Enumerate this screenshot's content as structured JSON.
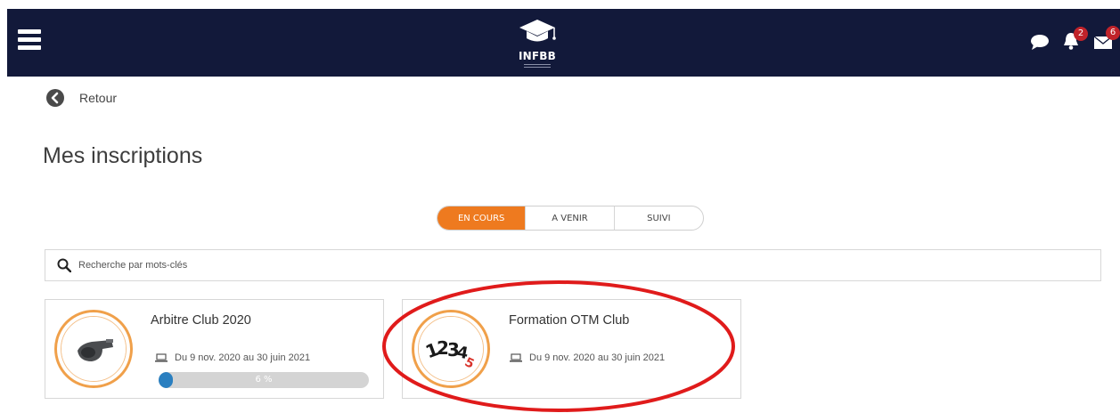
{
  "header": {
    "logo_text": "INFBB",
    "notifications_count": "2",
    "messages_count": "6",
    "bar_color": "#12193a"
  },
  "nav": {
    "back_label": "Retour"
  },
  "page": {
    "title": "Mes inscriptions"
  },
  "tabs": [
    {
      "label": "EN COURS",
      "active": true
    },
    {
      "label": "A VENIR",
      "active": false
    },
    {
      "label": "SUIVI",
      "active": false
    }
  ],
  "search": {
    "placeholder": "Recherche par mots-clés"
  },
  "courses": [
    {
      "title": "Arbitre Club 2020",
      "dates": "Du 9 nov. 2020 au 30 juin 2021",
      "progress_label": "6 %",
      "progress_value": 0.06,
      "icon": "whistle-icon"
    },
    {
      "title": "Formation OTM Club",
      "dates": "Du 9 nov. 2020 au 30 juin 2021",
      "icon": "numbers-12345-icon"
    }
  ],
  "colors": {
    "accent": "#ee7a1f",
    "progress": "#2a7fc0",
    "annotation": "#e01b1b"
  }
}
